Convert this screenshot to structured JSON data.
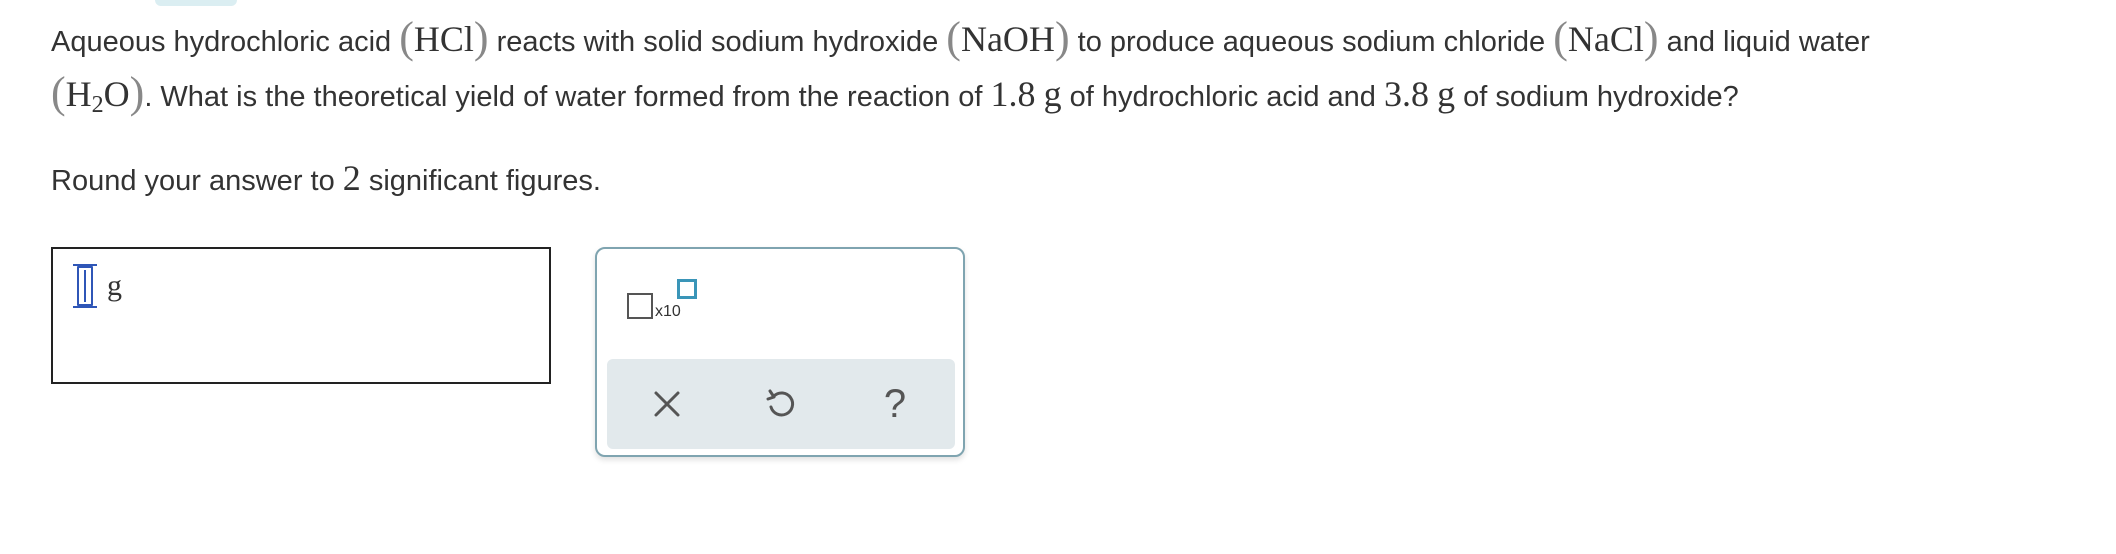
{
  "question": {
    "part1": "Aqueous hydrochloric acid ",
    "hcl": "HCl",
    "part2": " reacts with solid sodium hydroxide ",
    "naoh": "NaOH",
    "part3": " to produce aqueous sodium chloride ",
    "nacl": "NaCl",
    "part4": " and liquid water",
    "h2o_h": "H",
    "h2o_sub": "2",
    "h2o_o": "O",
    "part5": ". What is the theoretical yield of water formed from the reaction of ",
    "mass1": "1.8",
    "unit1": "g",
    "part6": " of hydrochloric acid and ",
    "mass2": "3.8",
    "unit2": "g",
    "part7": " of sodium hydroxide?"
  },
  "instruction": {
    "before": "Round your answer to ",
    "sigfigs": "2",
    "after": " significant figures."
  },
  "answer": {
    "value": "",
    "unit": "g"
  },
  "palette": {
    "x10_text": "x10",
    "clear_icon": "x-icon",
    "undo_icon": "undo-icon",
    "help_label": "?"
  },
  "colors": {
    "cursor": "#2f56b7",
    "palette_border": "#7fa4b0",
    "exponent_box": "#3a95b8",
    "actions_bg": "#e2e9ec"
  }
}
